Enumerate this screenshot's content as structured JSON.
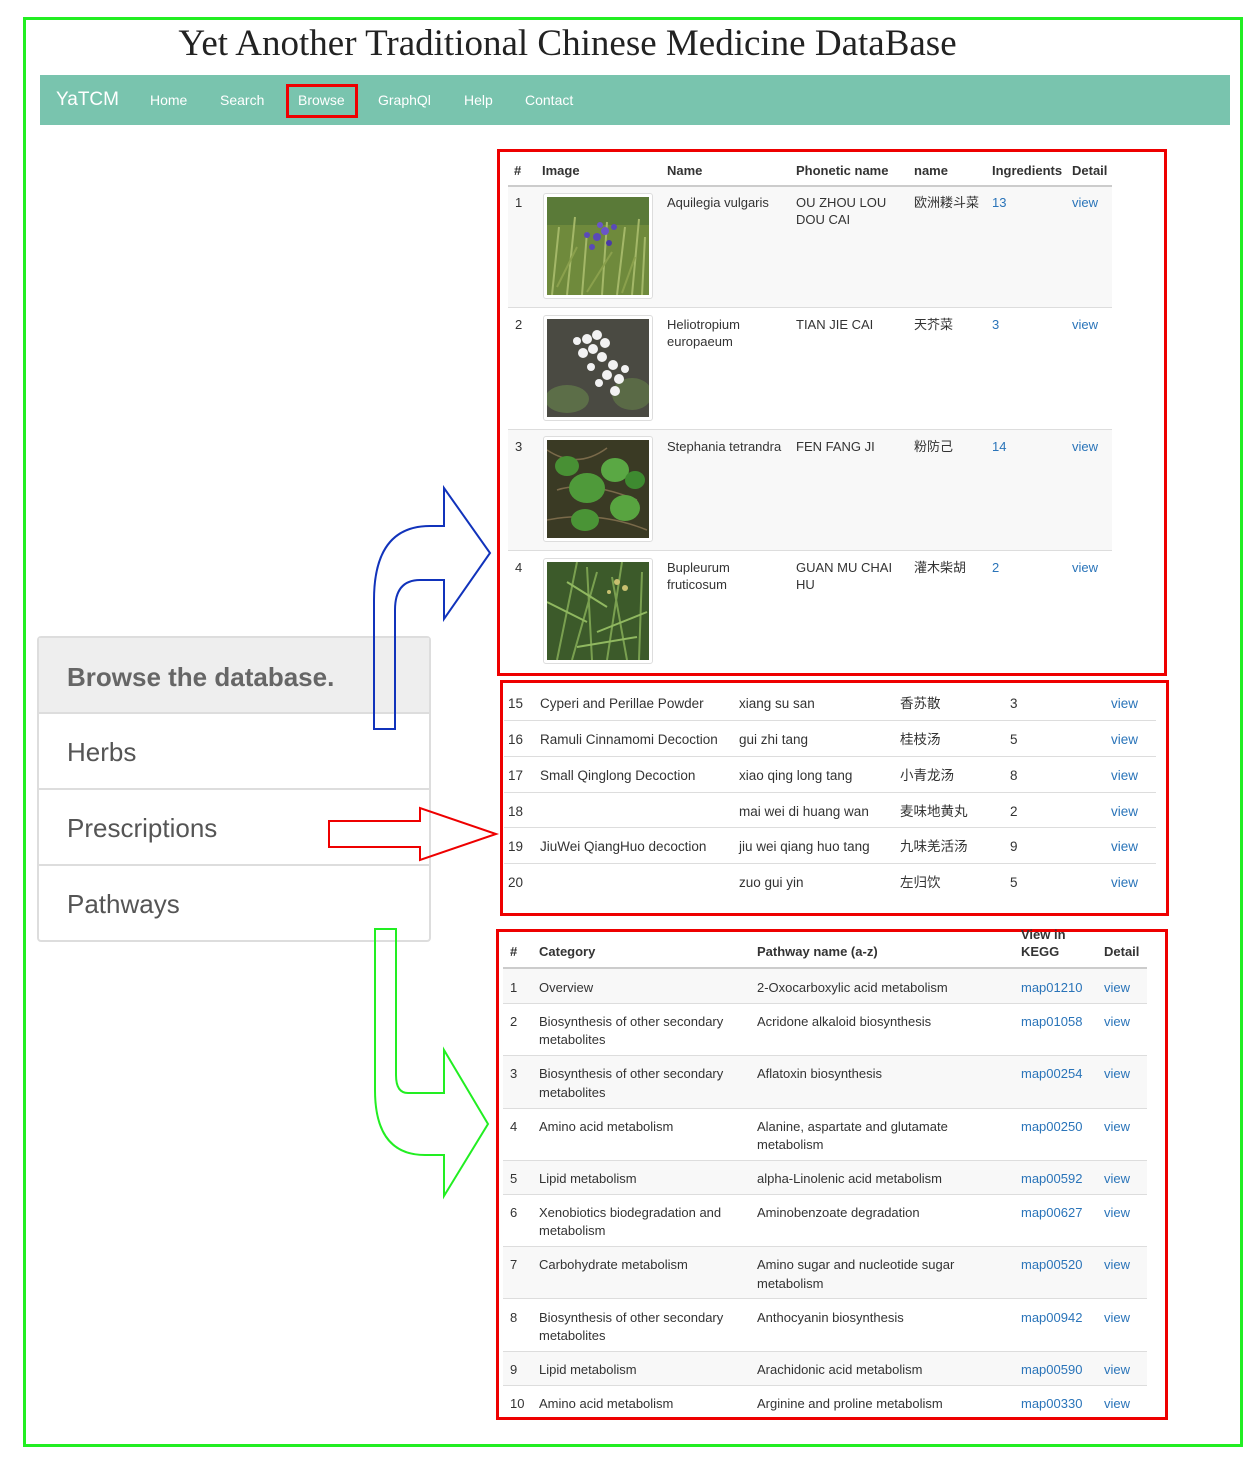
{
  "page_title": "Yet Another Traditional Chinese Medicine DataBase",
  "navbar": {
    "brand": "YaTCM",
    "items": [
      "Home",
      "Search",
      "Browse",
      "GraphQl",
      "Help",
      "Contact"
    ],
    "active": "Browse",
    "color": "#79c4ae"
  },
  "browse_panel": {
    "heading": "Browse the database.",
    "items": [
      "Herbs",
      "Prescriptions",
      "Pathways"
    ]
  },
  "herbs_table": {
    "headers": [
      "#",
      "Image",
      "Name",
      "Phonetic name",
      "name",
      "Ingredients",
      "Detail"
    ],
    "rows": [
      {
        "num": "1",
        "image_icon": "herb-photo-purple-flowers",
        "name_line1": "Aquilegia vulgaris",
        "name_line2": "",
        "phonetic_line1": "OU ZHOU LOU",
        "phonetic_line2": "DOU CAI",
        "cn": "欧洲耧斗菜",
        "ingredients": "13",
        "detail": "view"
      },
      {
        "num": "2",
        "image_icon": "herb-photo-white-flowers",
        "name_line1": "Heliotropium",
        "name_line2": "europaeum",
        "phonetic_line1": "TIAN JIE CAI",
        "phonetic_line2": "",
        "cn": "天芥菜",
        "ingredients": "3",
        "detail": "view"
      },
      {
        "num": "3",
        "image_icon": "herb-photo-green-leaves",
        "name_line1": "Stephania tetrandra",
        "name_line2": "",
        "phonetic_line1": "FEN FANG JI",
        "phonetic_line2": "",
        "cn": "粉防己",
        "ingredients": "14",
        "detail": "view"
      },
      {
        "num": "4",
        "image_icon": "herb-photo-shrub",
        "name_line1": "Bupleurum",
        "name_line2": "fruticosum",
        "phonetic_line1": "GUAN MU CHAI",
        "phonetic_line2": "HU",
        "cn": "灌木柴胡",
        "ingredients": "2",
        "detail": "view"
      }
    ]
  },
  "prescriptions_table": {
    "rows": [
      {
        "num": "15",
        "name": "Cyperi and Perillae Powder",
        "pinyin": "xiang su san",
        "cn": "香苏散",
        "count": "3",
        "detail": "view"
      },
      {
        "num": "16",
        "name": "Ramuli Cinnamomi Decoction",
        "pinyin": "gui zhi tang",
        "cn": "桂枝汤",
        "count": "5",
        "detail": "view"
      },
      {
        "num": "17",
        "name": "Small Qinglong Decoction",
        "pinyin": "xiao qing long tang",
        "cn": "小青龙汤",
        "count": "8",
        "detail": "view"
      },
      {
        "num": "18",
        "name": "",
        "pinyin": "mai wei di huang wan",
        "cn": "麦味地黄丸",
        "count": "2",
        "detail": "view"
      },
      {
        "num": "19",
        "name": "JiuWei QiangHuo decoction",
        "pinyin": "jiu wei qiang huo tang",
        "cn": "九味羌活汤",
        "count": "9",
        "detail": "view"
      },
      {
        "num": "20",
        "name": "",
        "pinyin": "zuo gui yin",
        "cn": "左归饮",
        "count": "5",
        "detail": "view"
      }
    ]
  },
  "pathways_table": {
    "headers": {
      "num": "#",
      "category": "Category",
      "pathway": "Pathway name (a-z)",
      "kegg_line1": "View in",
      "kegg_line2": "KEGG",
      "detail": "Detail"
    },
    "rows": [
      {
        "num": "1",
        "cat1": "Overview",
        "cat2": "",
        "path1": "2-Oxocarboxylic acid metabolism",
        "path2": "",
        "kegg": "map01210",
        "detail": "view"
      },
      {
        "num": "2",
        "cat1": "Biosynthesis of other secondary",
        "cat2": "metabolites",
        "path1": "Acridone alkaloid biosynthesis",
        "path2": "",
        "kegg": "map01058",
        "detail": "view"
      },
      {
        "num": "3",
        "cat1": "Biosynthesis of other secondary",
        "cat2": "metabolites",
        "path1": "Aflatoxin biosynthesis",
        "path2": "",
        "kegg": "map00254",
        "detail": "view"
      },
      {
        "num": "4",
        "cat1": "Amino acid metabolism",
        "cat2": "",
        "path1": "Alanine, aspartate and glutamate",
        "path2": "metabolism",
        "kegg": "map00250",
        "detail": "view"
      },
      {
        "num": "5",
        "cat1": "Lipid metabolism",
        "cat2": "",
        "path1": "alpha-Linolenic acid metabolism",
        "path2": "",
        "kegg": "map00592",
        "detail": "view"
      },
      {
        "num": "6",
        "cat1": "Xenobiotics biodegradation and",
        "cat2": "metabolism",
        "path1": "Aminobenzoate degradation",
        "path2": "",
        "kegg": "map00627",
        "detail": "view"
      },
      {
        "num": "7",
        "cat1": "Carbohydrate metabolism",
        "cat2": "",
        "path1": "Amino sugar and nucleotide sugar",
        "path2": "metabolism",
        "kegg": "map00520",
        "detail": "view"
      },
      {
        "num": "8",
        "cat1": "Biosynthesis of other secondary",
        "cat2": "metabolites",
        "path1": "Anthocyanin biosynthesis",
        "path2": "",
        "kegg": "map00942",
        "detail": "view"
      },
      {
        "num": "9",
        "cat1": "Lipid metabolism",
        "cat2": "",
        "path1": "Arachidonic acid metabolism",
        "path2": "",
        "kegg": "map00590",
        "detail": "view"
      },
      {
        "num": "10",
        "cat1": "Amino acid metabolism",
        "cat2": "",
        "path1": "Arginine and proline metabolism",
        "path2": "",
        "kegg": "map00330",
        "detail": "view"
      }
    ]
  },
  "annotation_colors": {
    "outer_frame": "#22ee22",
    "highlight_box": "#ee0000",
    "herbs_arrow": "#1133bb",
    "prescriptions_arrow": "#ee0000",
    "pathways_arrow": "#22ee22"
  }
}
